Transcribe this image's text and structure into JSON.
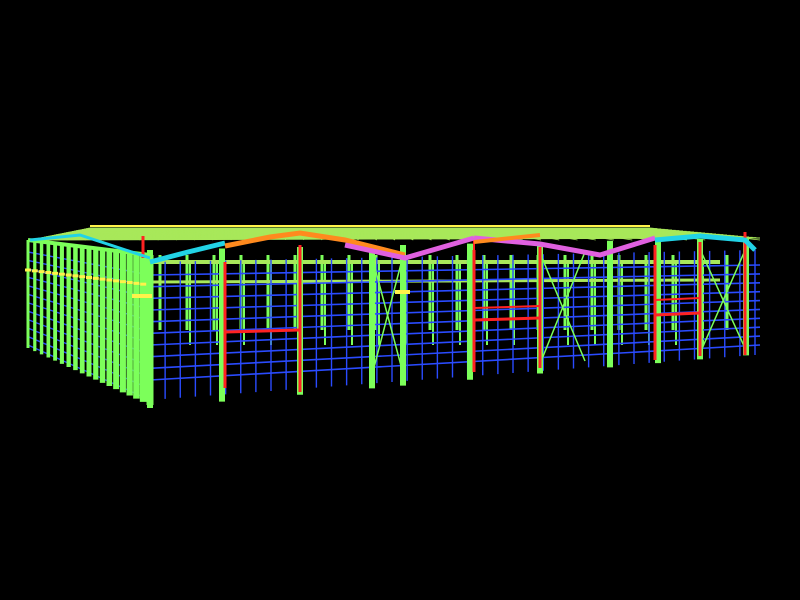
{
  "viewport": {
    "background": "#000000"
  },
  "model": {
    "colors": {
      "columns": "#7CFF5A",
      "girts": "#2A4BFF",
      "end_frames": "#FF2222",
      "rafters_cyan": "#22D3E6",
      "rafters_orange": "#FF8A1E",
      "rafters_magenta": "#E060E0",
      "purlins": "#A8E85A",
      "highlight_yellow": "#FFF24A"
    }
  }
}
